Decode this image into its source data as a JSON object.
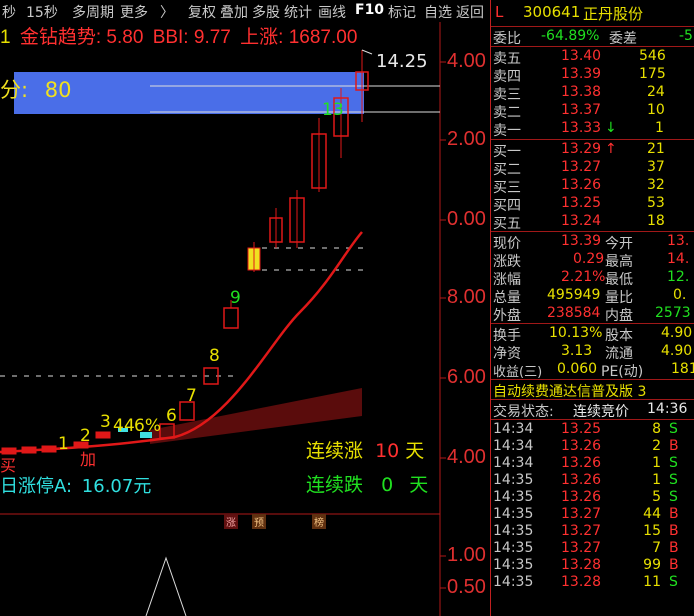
{
  "toolbar": {
    "items": [
      "秒",
      "15秒",
      "多周期",
      "更多",
      "〉",
      "复权",
      "叠加",
      "多股",
      "统计",
      "画线",
      "F10",
      "标记",
      "自选",
      "返回"
    ]
  },
  "indicator": {
    "prefix": "1",
    "name": "金钻趋势:",
    "value": "5.80",
    "bbi_label": "BBI:",
    "bbi_value": "9.77",
    "up_label": "上涨:",
    "up_value": "1687.00"
  },
  "overlay": {
    "label": "分:",
    "value": "80"
  },
  "price_marker": "14.25",
  "y_axis": [
    "4.00",
    "2.00",
    "0.00",
    "8.00",
    "6.00",
    "4.00"
  ],
  "y_axis_lower": [
    "1.00",
    "0.50"
  ],
  "candle_labels": [
    "1",
    "2",
    "3",
    "4",
    "4",
    "6%",
    "6",
    "7",
    "8",
    "9",
    "13"
  ],
  "streak": {
    "up_label": "连续涨",
    "up_count": "10",
    "down_label": "连续跌",
    "down_count": "0",
    "unit": "天"
  },
  "buy_marker": "买",
  "add_marker": "加",
  "limit_up": {
    "label": "日涨停A:",
    "value": "16.07元"
  },
  "event_tags": [
    "涨",
    "预",
    "榜"
  ],
  "stock": {
    "flag": "L",
    "code": "300641",
    "name": "正丹股份"
  },
  "weibi": {
    "label": "委比",
    "value": "-64.89%",
    "label2": "委差",
    "value2": "-5"
  },
  "asks": [
    {
      "label": "卖五",
      "price": "13.40",
      "vol": "546"
    },
    {
      "label": "卖四",
      "price": "13.39",
      "vol": "175"
    },
    {
      "label": "卖三",
      "price": "13.38",
      "vol": "24"
    },
    {
      "label": "卖二",
      "price": "13.37",
      "vol": "10"
    },
    {
      "label": "卖一",
      "price": "13.33",
      "vol": "1",
      "arrow": "↓"
    }
  ],
  "bids": [
    {
      "label": "买一",
      "price": "13.29",
      "vol": "21",
      "arrow": "↑"
    },
    {
      "label": "买二",
      "price": "13.27",
      "vol": "37"
    },
    {
      "label": "买三",
      "price": "13.26",
      "vol": "32"
    },
    {
      "label": "买四",
      "price": "13.25",
      "vol": "53"
    },
    {
      "label": "买五",
      "price": "13.24",
      "vol": "18"
    }
  ],
  "quote": [
    {
      "l1": "现价",
      "v1": "13.39",
      "l2": "今开",
      "v2": "13."
    },
    {
      "l1": "涨跌",
      "v1": "0.29",
      "l2": "最高",
      "v2": "14."
    },
    {
      "l1": "涨幅",
      "v1": "2.21%",
      "l2": "最低",
      "v2": "12."
    },
    {
      "l1": "总量",
      "v1": "495949",
      "l2": "量比",
      "v2": "0."
    },
    {
      "l1": "外盘",
      "v1": "238584",
      "l2": "内盘",
      "v2": "2573"
    }
  ],
  "fundamentals": [
    {
      "l1": "换手",
      "v1": "10.13%",
      "l2": "股本",
      "v2": "4.90"
    },
    {
      "l1": "净资",
      "v1": "3.13",
      "l2": "流通",
      "v2": "4.90"
    },
    {
      "l1": "收益(三)",
      "v1": "0.060",
      "l2": "PE(动)",
      "v2": "181"
    }
  ],
  "promo": "自动续费通达信普及版 3",
  "trade_status": {
    "label": "交易状态:",
    "value": "连续竞价",
    "time": "14:36"
  },
  "ticks": [
    {
      "time": "14:34",
      "price": "13.25",
      "vol": "8",
      "side": "S"
    },
    {
      "time": "14:34",
      "price": "13.26",
      "vol": "2",
      "side": "B"
    },
    {
      "time": "14:34",
      "price": "13.26",
      "vol": "1",
      "side": "S"
    },
    {
      "time": "14:35",
      "price": "13.26",
      "vol": "1",
      "side": "S"
    },
    {
      "time": "14:35",
      "price": "13.26",
      "vol": "5",
      "side": "S"
    },
    {
      "time": "14:35",
      "price": "13.27",
      "vol": "44",
      "side": "B"
    },
    {
      "time": "14:35",
      "price": "13.27",
      "vol": "15",
      "side": "B"
    },
    {
      "time": "14:35",
      "price": "13.27",
      "vol": "7",
      "side": "B"
    },
    {
      "time": "14:35",
      "price": "13.28",
      "vol": "99",
      "side": "B"
    },
    {
      "time": "14:35",
      "price": "13.28",
      "vol": "11",
      "side": "S"
    }
  ],
  "colors": {
    "up": "#ff3030",
    "down": "#20e020",
    "accent_blue": "#4a6ee8",
    "yellow": "#e8e000"
  }
}
